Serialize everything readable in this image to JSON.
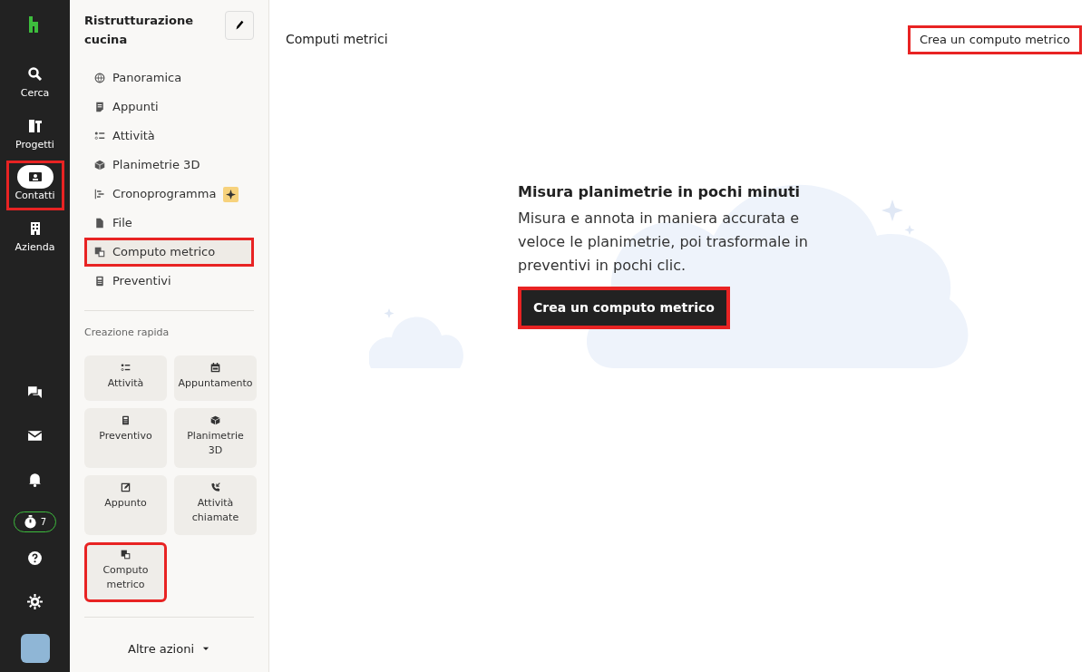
{
  "rail": {
    "items": [
      {
        "label": "Cerca",
        "selected": false,
        "highlighted": false
      },
      {
        "label": "Progetti",
        "selected": false,
        "highlighted": false
      },
      {
        "label": "Contatti",
        "selected": true,
        "highlighted": true
      },
      {
        "label": "Azienda",
        "selected": false,
        "highlighted": false
      }
    ],
    "timer_count": "7"
  },
  "sidebar": {
    "title": "Ristrutturazione cucina",
    "items": [
      {
        "label": "Panoramica",
        "selected": false,
        "highlighted": false,
        "badge": false
      },
      {
        "label": "Appunti",
        "selected": false,
        "highlighted": false,
        "badge": false
      },
      {
        "label": "Attività",
        "selected": false,
        "highlighted": false,
        "badge": false
      },
      {
        "label": "Planimetrie 3D",
        "selected": false,
        "highlighted": false,
        "badge": false
      },
      {
        "label": "Cronoprogramma",
        "selected": false,
        "highlighted": false,
        "badge": true
      },
      {
        "label": "File",
        "selected": false,
        "highlighted": false,
        "badge": false
      },
      {
        "label": "Computo metrico",
        "selected": true,
        "highlighted": true,
        "badge": false
      },
      {
        "label": "Preventivi",
        "selected": false,
        "highlighted": false,
        "badge": false
      }
    ],
    "quick_create_heading": "Creazione rapida",
    "quick_create": [
      {
        "label": "Attività",
        "highlighted": false
      },
      {
        "label": "Appuntamento",
        "highlighted": false
      },
      {
        "label": "Preventivo",
        "highlighted": false
      },
      {
        "label": "Planimetrie 3D",
        "highlighted": false
      },
      {
        "label": "Appunto",
        "highlighted": false
      },
      {
        "label": "Attività chiamate",
        "highlighted": false
      },
      {
        "label": "Computo metrico",
        "highlighted": true
      }
    ],
    "more_actions": "Altre azioni"
  },
  "main": {
    "title": "Computi metrici",
    "header_button": {
      "label": "Crea un computo metrico",
      "highlighted": true
    },
    "empty_state": {
      "heading": "Misura planimetrie in pochi minuti",
      "text": "Misura e annota in maniera accurata e veloce le planimetrie, poi trasformale in preventivi in pochi clic.",
      "button": {
        "label": "Crea un computo metrico",
        "highlighted": true
      }
    }
  }
}
